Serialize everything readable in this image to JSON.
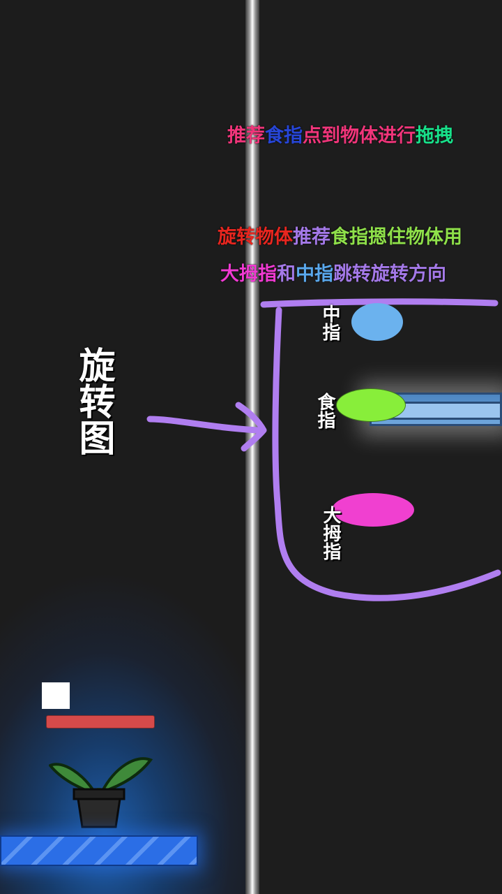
{
  "tips": {
    "line1": [
      {
        "text": "推荐",
        "color": "#f0357a"
      },
      {
        "text": "食指",
        "color": "#2746d8"
      },
      {
        "text": "点到物体进行",
        "color": "#f0357a"
      },
      {
        "text": "拖拽",
        "color": "#18e08a"
      }
    ],
    "line2": [
      {
        "text": "旋转物体",
        "color": "#e8261f"
      },
      {
        "text": "推荐",
        "color": "#a479e8"
      },
      {
        "text": "食指摁住物体用",
        "color": "#8fe04a"
      }
    ],
    "line3": [
      {
        "text": "大拇指",
        "color": "#f03ad2"
      },
      {
        "text": "和",
        "color": "#a479e8"
      },
      {
        "text": "中指",
        "color": "#5aa8ec"
      },
      {
        "text": "跳转旋转方向",
        "color": "#a479e8"
      }
    ]
  },
  "rotation_label": "旋转图",
  "fingers": {
    "middle": {
      "label": "中指",
      "color": "#6bb2ee"
    },
    "index": {
      "label": "食指",
      "color": "#88ee3a"
    },
    "thumb": {
      "label": "大拇指",
      "color": "#f040d0"
    }
  },
  "annotation_color": "#b07ef0"
}
